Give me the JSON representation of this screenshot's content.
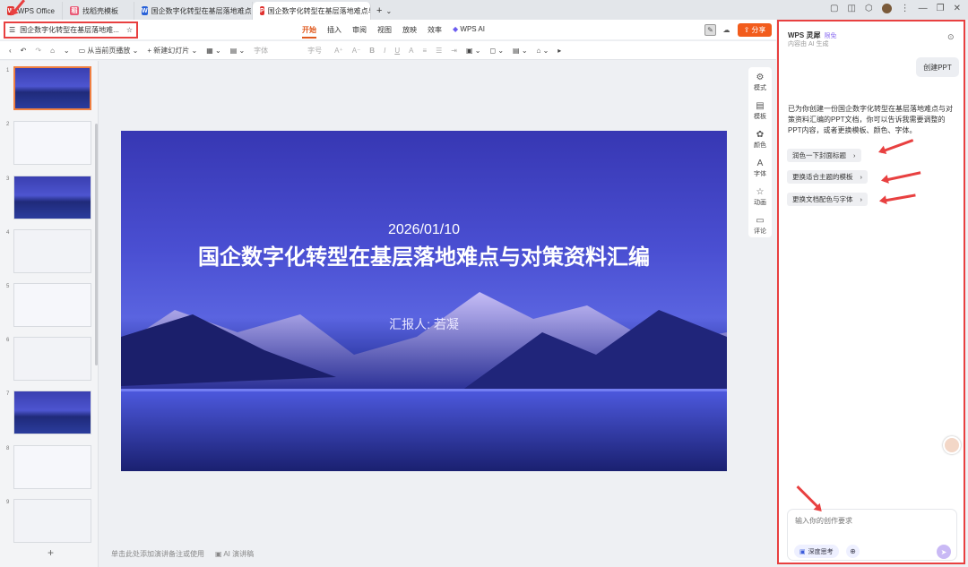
{
  "tabs": [
    {
      "label": "WPS Office",
      "color": "#e0322f",
      "glyph": "W"
    },
    {
      "label": "找稻壳模板",
      "color": "#e85a77",
      "glyph": "稻"
    },
    {
      "label": "国企数字化转型在基层落地难点与对",
      "color": "#2a62d8",
      "glyph": "W"
    },
    {
      "label": "国企数字化转型在基层落地难点与",
      "color": "#e0322f",
      "glyph": "P"
    }
  ],
  "doc_title": "国企数字化转型在基层落地难...",
  "menus": [
    "开始",
    "插入",
    "审阅",
    "视图",
    "放映",
    "效率",
    "WPS AI"
  ],
  "share_label": "分享",
  "toolbar": {
    "play_from_current": "从当前页播放",
    "new_slide": "新建幻灯片",
    "font": "字体",
    "size": "字号"
  },
  "thumb_numbers": [
    "1",
    "2",
    "3",
    "4",
    "5",
    "6",
    "7",
    "8",
    "9"
  ],
  "slide": {
    "date": "2026/01/10",
    "title": "国企数字化转型在基层落地难点与对策资料汇编",
    "reporter": "汇报人: 若凝"
  },
  "notes_placeholder": "单击此处添加演讲备注或使用",
  "notes_ai": "AI 演讲稿",
  "sidetools": [
    {
      "icon": "palette-icon",
      "glyph": "⚙",
      "label": "模式"
    },
    {
      "icon": "template-icon",
      "glyph": "▤",
      "label": "模板"
    },
    {
      "icon": "color-icon",
      "glyph": "✿",
      "label": "颜色"
    },
    {
      "icon": "font-icon",
      "glyph": "A",
      "label": "字体"
    },
    {
      "icon": "animation-icon",
      "glyph": "☆",
      "label": "动画"
    },
    {
      "icon": "comment-icon",
      "glyph": "▭",
      "label": "评论"
    }
  ],
  "panel": {
    "name": "WPS 灵犀",
    "badge": "限免",
    "subtitle": "内容由 AI 生成",
    "user_message": "创建PPT",
    "assistant_message": "已为你创建一份国企数字化转型在基层落地难点与对策资料汇编的PPT文档，你可以告诉我需要调整的PPT内容，或者更换模板、颜色、字体。",
    "chips": [
      "润色一下封面标题",
      "更换适合主题的模板",
      "更换文档配色与字体"
    ],
    "input_placeholder": "输入你的创作要求",
    "deep_think": "深度思考"
  }
}
